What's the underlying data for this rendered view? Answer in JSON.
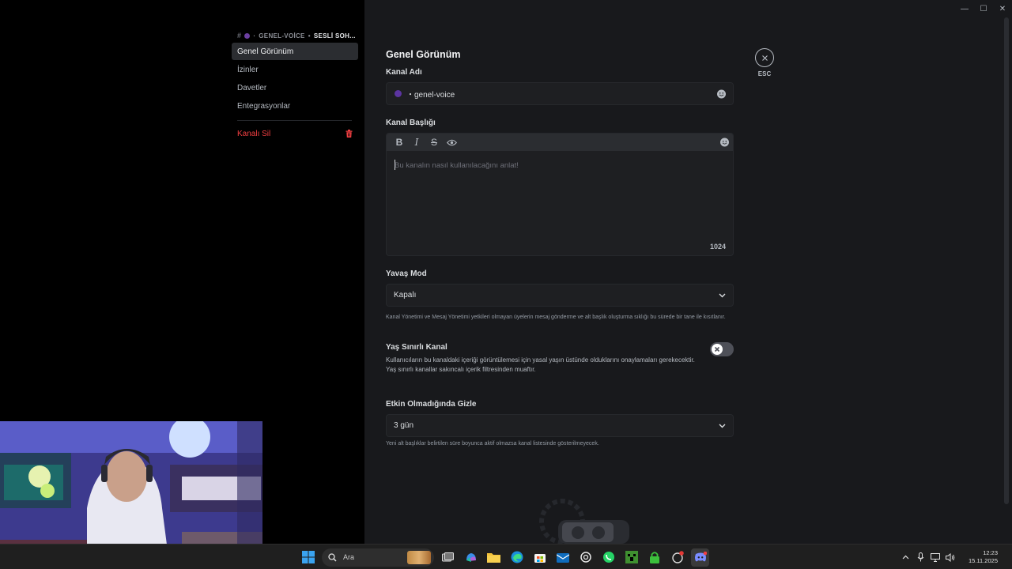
{
  "window": {
    "minimize": "—",
    "maximize": "☐",
    "close": "✕"
  },
  "breadcrumb": {
    "hash": "#",
    "channel": "GENEL-VOİCE",
    "category": "SESLİ SOH..."
  },
  "sidebar": {
    "items": [
      {
        "label": "Genel Görünüm",
        "active": true
      },
      {
        "label": "İzinler"
      },
      {
        "label": "Davetler"
      },
      {
        "label": "Entegrasyonlar"
      }
    ],
    "delete_label": "Kanalı Sil"
  },
  "main": {
    "title": "Genel Görünüm",
    "channel_name_label": "Kanal Adı",
    "channel_name_value": "・genel-voice",
    "topic_label": "Kanal Başlığı",
    "topic_placeholder": "Bu kanalın nasıl kullanılacağını anlat!",
    "topic_counter": "1024",
    "slowmode_label": "Yavaş Mod",
    "slowmode_value": "Kapalı",
    "slowmode_help": "Kanal Yönetimi ve Mesaj Yönetimi yetkileri olmayan üyelerin mesaj gönderme ve alt başlık oluşturma sıklığı bu sürede bir tane ile kısıtlanır.",
    "age_label": "Yaş Sınırlı Kanal",
    "age_desc": "Kullanıcıların bu kanaldaki içeriği görüntülemesi için yasal yaşın üstünde olduklarını onaylamaları gerekecektir. Yaş sınırlı kanallar sakıncalı içerik filtresinden muaftır.",
    "age_enabled": false,
    "hide_label": "Etkin Olmadığında Gizle",
    "hide_value": "3 gün",
    "hide_help": "Yeni alt başlıklar belirtilen süre boyunca aktif olmazsa kanal listesinde gösterilmeyecek.",
    "esc_label": "ESC"
  },
  "toolbar": {
    "bold": "B",
    "italic": "I",
    "strike": "S"
  },
  "taskbar": {
    "search_label": "Ara",
    "time": "12:23",
    "date": "15.11.2025"
  },
  "colors": {
    "accent_danger": "#f23f42",
    "panel_bg": "#18191c",
    "input_bg": "#1e1f22"
  }
}
